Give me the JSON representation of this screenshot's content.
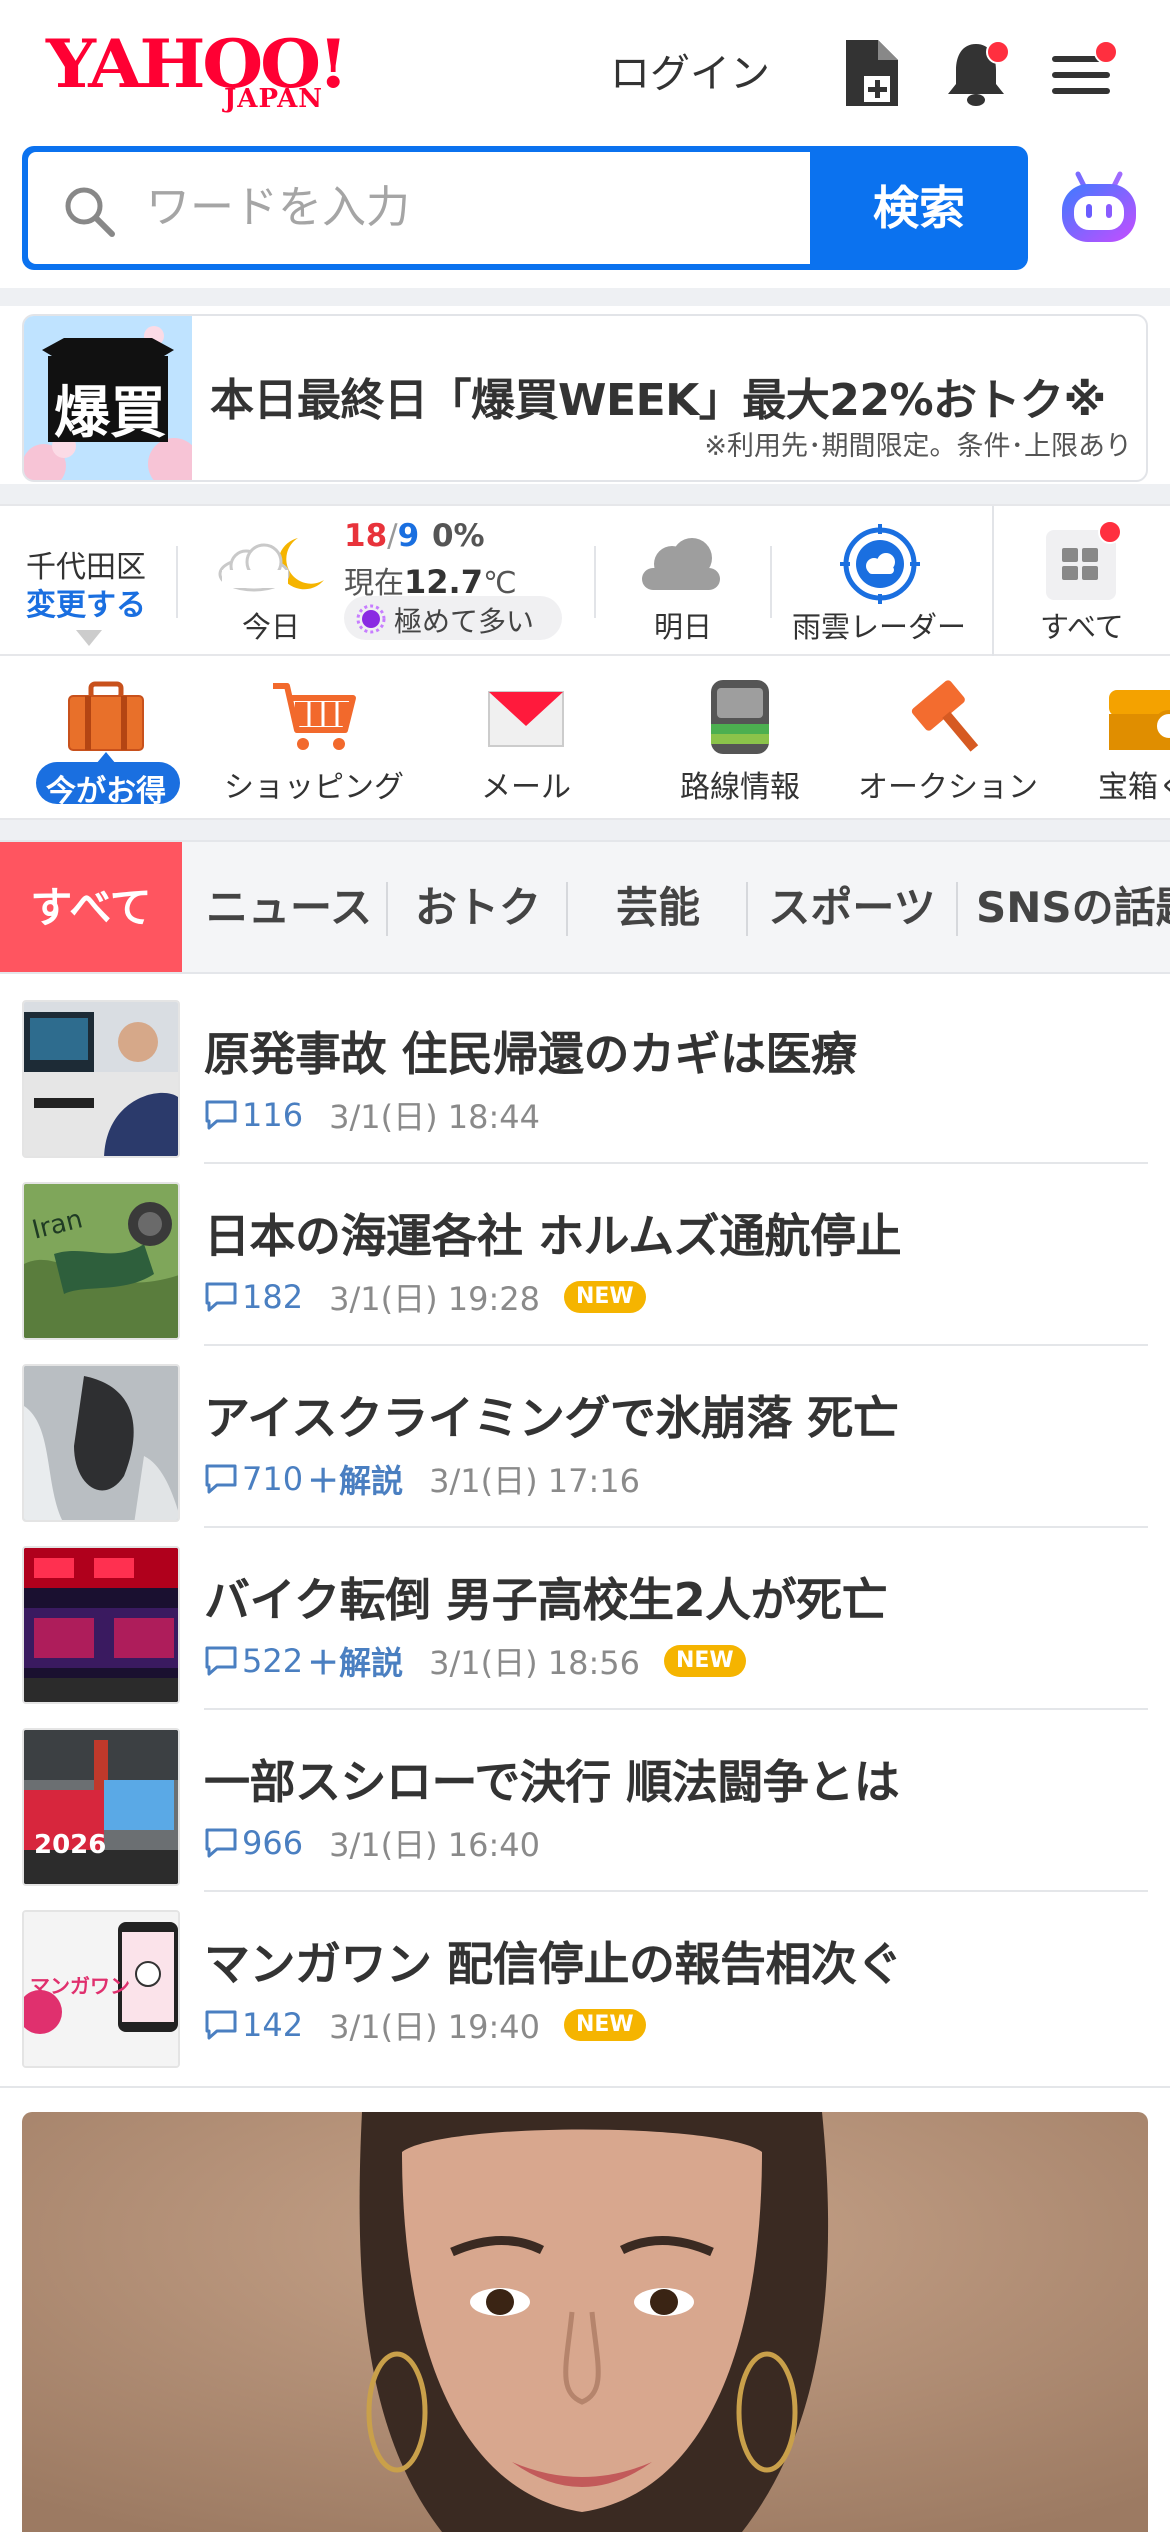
{
  "header": {
    "logo_main": "YAHOO!",
    "logo_sub": "JAPAN",
    "login_label": "ログイン",
    "icons": [
      "add-document-icon",
      "bell-icon",
      "menu-icon"
    ]
  },
  "search": {
    "placeholder": "ワードを入力",
    "button_label": "検索",
    "accent_color": "#0b72ef"
  },
  "banner": {
    "image_text": "爆買",
    "title": "本日最終日「爆買WEEK」最大22%おトク※",
    "note": "※利用先･期間限定。条件･上限あり"
  },
  "weather": {
    "location": "千代田区",
    "change_label": "変更する",
    "high": "18",
    "slash": "/",
    "low": "9",
    "precip": "0%",
    "current_label": "現在",
    "current_temp": "12.7",
    "temp_unit": "℃",
    "pollen": "極めて多い",
    "today_label": "今日",
    "tomorrow_label": "明日",
    "radar_label": "雨雲レーダー",
    "all_label": "すべて"
  },
  "services": [
    {
      "label": "今がお得",
      "icon": "briefcase-icon"
    },
    {
      "label": "ショッピング",
      "icon": "shopping-cart-icon"
    },
    {
      "label": "メール",
      "icon": "mail-icon"
    },
    {
      "label": "路線情報",
      "icon": "train-icon"
    },
    {
      "label": "オークション",
      "icon": "auction-hammer-icon"
    },
    {
      "label": "宝箱く",
      "icon": "treasure-box-icon"
    }
  ],
  "tabs": [
    "すべて",
    "ニュース",
    "おトク",
    "芸能",
    "スポーツ",
    "SNSの話題"
  ],
  "news": [
    {
      "title": "原発事故 住民帰還のカギは医療",
      "count": "116",
      "extra": "",
      "date": "3/1(日) 18:44",
      "is_new": false
    },
    {
      "title": "日本の海運各社 ホルムズ通航停止",
      "count": "182",
      "extra": "",
      "date": "3/1(日) 19:28",
      "is_new": true
    },
    {
      "title": "アイスクライミングで氷崩落 死亡",
      "count": "710",
      "extra": "＋解説",
      "date": "3/1(日) 17:16",
      "is_new": false
    },
    {
      "title": "バイク転倒 男子高校生2人が死亡",
      "count": "522",
      "extra": "＋解説",
      "date": "3/1(日) 18:56",
      "is_new": true
    },
    {
      "title": "一部スシローで決行 順法闘争とは",
      "count": "966",
      "extra": "",
      "date": "3/1(日) 16:40",
      "is_new": false
    },
    {
      "title": "マンガワン 配信停止の報告相次ぐ",
      "count": "142",
      "extra": "",
      "date": "3/1(日) 19:40",
      "is_new": true
    }
  ],
  "thumb_texts": {
    "iran": "Iran",
    "year": "2026",
    "manga": "マンガワン"
  },
  "new_badge": "NEW"
}
